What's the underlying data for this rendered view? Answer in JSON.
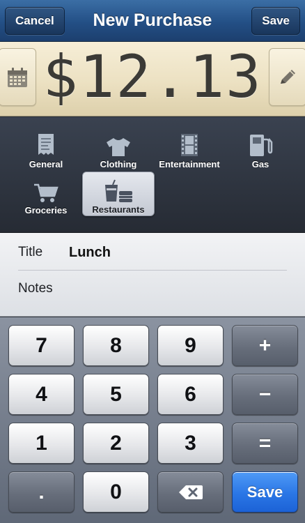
{
  "navbar": {
    "cancel_label": "Cancel",
    "title": "New Purchase",
    "save_label": "Save"
  },
  "amount": {
    "value": "$12.13",
    "left_icon": "calendar-icon",
    "right_icon": "pencil-icon"
  },
  "categories": [
    {
      "label": "General",
      "icon": "receipt-icon",
      "selected": false
    },
    {
      "label": "Clothing",
      "icon": "tshirt-icon",
      "selected": false
    },
    {
      "label": "Entertainment",
      "icon": "film-icon",
      "selected": false
    },
    {
      "label": "Gas",
      "icon": "gas-pump-icon",
      "selected": false
    },
    {
      "label": "Groceries",
      "icon": "shopping-cart-icon",
      "selected": false
    },
    {
      "label": "Restaurants",
      "icon": "restaurant-icon",
      "selected": true
    }
  ],
  "form": {
    "title_label": "Title",
    "title_value": "Lunch",
    "notes_label": "Notes",
    "notes_value": ""
  },
  "keypad": {
    "keys": [
      "7",
      "8",
      "9",
      "+",
      "4",
      "5",
      "6",
      "−",
      "1",
      "2",
      "3",
      "=",
      ".",
      "0",
      "",
      "Save"
    ],
    "backspace_icon": "backspace-icon"
  },
  "colors": {
    "navbar": "#234f85",
    "amount_bg": "#ece1c2",
    "save_key": "#2a76e6"
  }
}
